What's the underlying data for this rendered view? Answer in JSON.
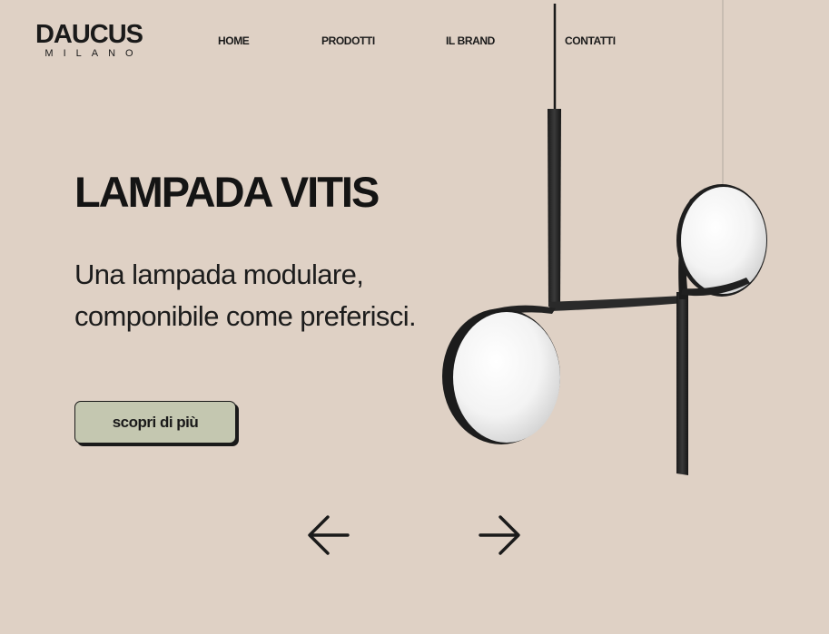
{
  "brand": {
    "name": "DAUCUS",
    "sub": "MILANO"
  },
  "nav": {
    "items": [
      "HOME",
      "PRODOTTI",
      "IL BRAND",
      "CONTATTI"
    ]
  },
  "hero": {
    "title": "LAMPADA VITIS",
    "text": "Una lampada modulare, componibile come preferisci.",
    "cta": "scopri di più"
  },
  "carousel": {
    "prev_icon": "arrow-left-icon",
    "next_icon": "arrow-right-icon"
  },
  "colors": {
    "background": "#dfd1c5",
    "cta_background": "#c4c7b0",
    "text": "#1c1c1c"
  }
}
